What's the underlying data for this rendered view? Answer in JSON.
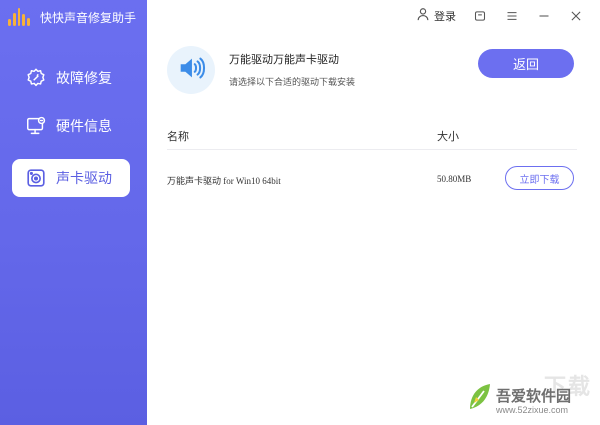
{
  "app": {
    "title": "快快声音修复助手"
  },
  "sidebar": {
    "items": [
      {
        "label": "故障修复",
        "icon": "gear-repair-icon",
        "active": false
      },
      {
        "label": "硬件信息",
        "icon": "monitor-icon",
        "active": false
      },
      {
        "label": "声卡驱动",
        "icon": "speaker-icon",
        "active": true
      }
    ]
  },
  "topbar": {
    "login_label": "登录",
    "icons": [
      "user-icon",
      "skin-icon",
      "menu-icon",
      "minimize-icon",
      "close-icon"
    ]
  },
  "header": {
    "title": "万能驱动万能声卡驱动",
    "subtitle": "请选择以下合适的驱动下载安装",
    "back_label": "返回"
  },
  "table": {
    "columns": [
      "名称",
      "大小"
    ],
    "rows": [
      {
        "name": "万能声卡驱动 for Win10 64bit",
        "size": "50.80MB",
        "action_label": "立即下载"
      }
    ]
  },
  "watermark": {
    "big": "下载",
    "name": "吾爱软件园",
    "url": "www.52zixue.com"
  },
  "colors": {
    "accent": "#6c6ff0",
    "sidebar": "#6468ea",
    "brand_bars": "#f7b23a",
    "sound_circle": "#e9f3fc"
  }
}
